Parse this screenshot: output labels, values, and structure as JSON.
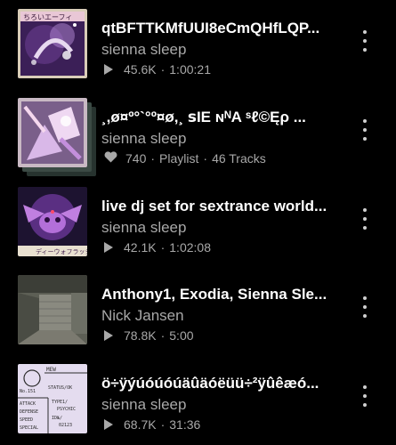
{
  "tracks": [
    {
      "title": "qtBFTTKMfUUI8eCmQHfLQP...",
      "artist": "sienna sleep",
      "stat_icon": "play-icon",
      "stat": "45.6K",
      "extra": "1:00:21",
      "art_label": "ちろいエーフィ"
    },
    {
      "title": "¸,ø¤º°`°º¤ø,¸ ꜱIE ɴᴺA ˢℓ©Ęρ ...",
      "artist": "sienna sleep",
      "stat_icon": "heart-icon",
      "stat": "740",
      "playlist_label": "Playlist",
      "extra": "46 Tracks"
    },
    {
      "title": "live dj set for sextrance world...",
      "artist": "sienna sleep",
      "stat_icon": "play-icon",
      "stat": "42.1K",
      "extra": "1:02:08",
      "art_label": "ディーウォフラッシ"
    },
    {
      "title": "Anthony1, Exodia, Sienna Sle...",
      "artist": "Nick Jansen",
      "stat_icon": "play-icon",
      "stat": "78.8K",
      "extra": "5:00"
    },
    {
      "title": "ö÷ÿýúóúóúäûäóëüü÷²ÿûêæó...",
      "artist": "sienna sleep",
      "stat_icon": "play-icon",
      "stat": "68.7K",
      "extra": "31:36",
      "art_lines": [
        "MEW",
        "No.151",
        "STATUS/OK",
        "ATTACK",
        "DEFENSE",
        "SPEED",
        "SPECIAL",
        "TYPE1/",
        "PSYCHIC",
        "ID№/",
        "02123"
      ]
    }
  ],
  "colors": {
    "background": "#000000",
    "title": "#ffffff",
    "secondary": "#a8a8a8"
  }
}
